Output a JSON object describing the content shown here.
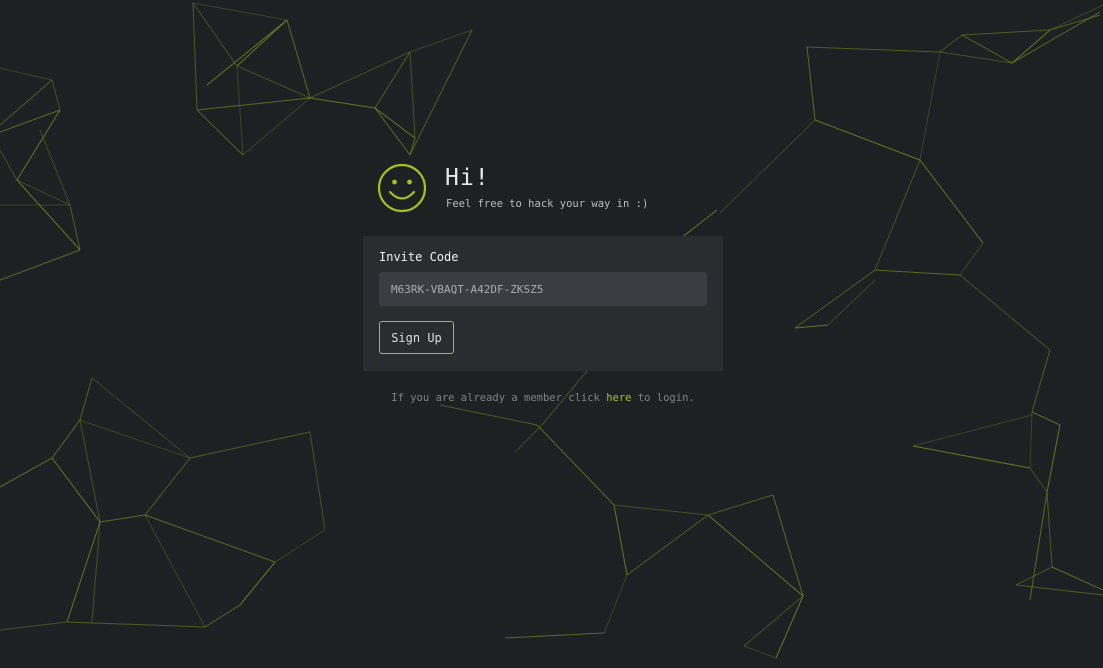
{
  "header": {
    "icon": "smiley-face-icon",
    "title": "Hi!",
    "subtitle": "Feel free to hack your way in :)"
  },
  "form": {
    "invite_label": "Invite Code",
    "invite_value": "M63RK-VBAQT-A42DF-ZKSZ5",
    "signup_label": "Sign Up"
  },
  "footer": {
    "prefix": "If you are already a member click ",
    "link_label": "here",
    "suffix": " to login."
  },
  "colors": {
    "background": "#1e2123",
    "card": "#2a2d30",
    "input": "#3a3e42",
    "accent": "#a1c31c",
    "network_lines": "#6f8a1c"
  }
}
